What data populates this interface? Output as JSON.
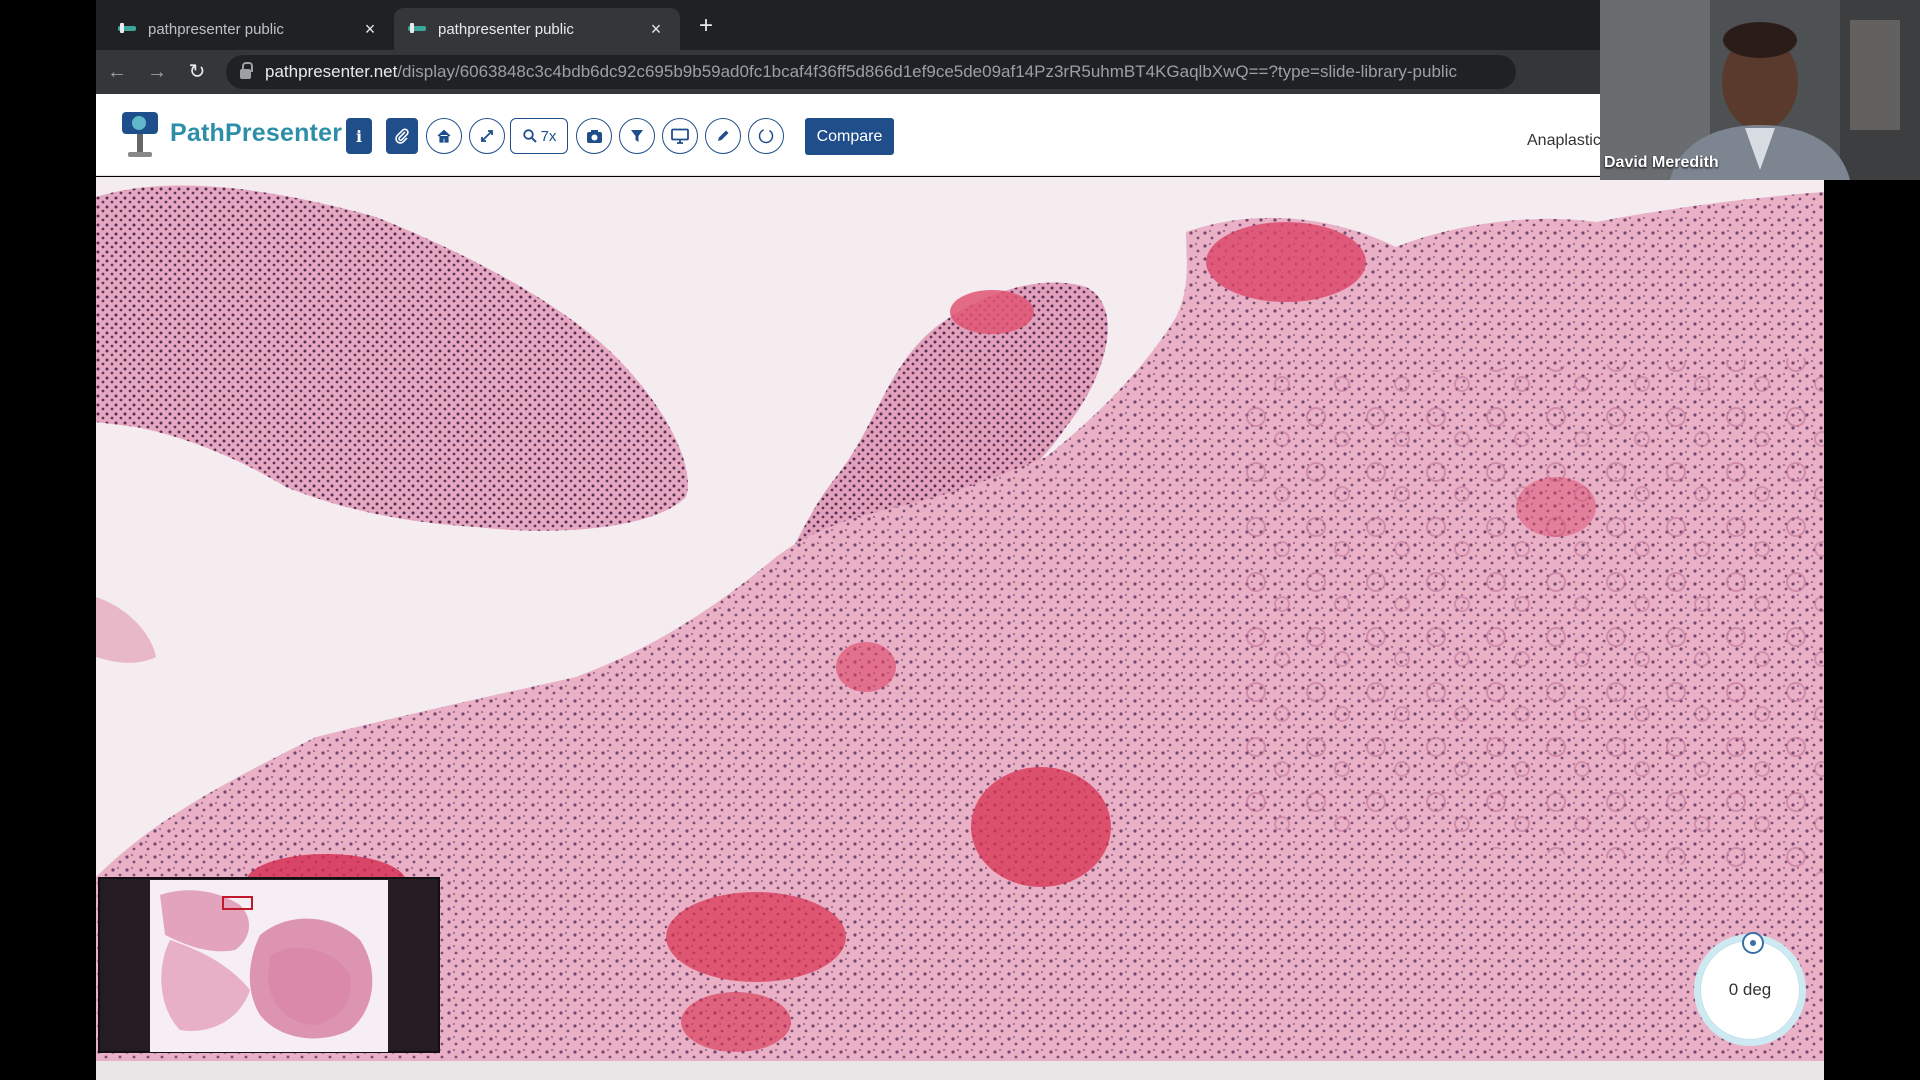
{
  "browser": {
    "tabs": [
      {
        "title": "pathpresenter public",
        "active": false
      },
      {
        "title": "pathpresenter public",
        "active": true
      }
    ],
    "new_tab_label": "+",
    "url_host": "pathpresenter.net",
    "url_path": "/display/6063848c3c4bdb6dc92c695b9b59ad0fc1bcaf4f36ff5d866d1ef9ce5de09af14Pz3rR5uhmBT4KGaqlbXwQ==?type=slide-library-public"
  },
  "app": {
    "logo_text": "PathPresenter",
    "toolbar": {
      "info_label": "i",
      "zoom_label": "7x",
      "compare_label": "Compare"
    },
    "slide_title": "Anaplastic"
  },
  "viewer": {
    "rotation_label": "0 deg"
  },
  "webcam": {
    "name": "David Meredith"
  },
  "colors": {
    "brand": "#1f4e8b",
    "logo_text": "#2d8ea8",
    "tissue_pink": "#e9a9bf",
    "hemorrhage": "#d9304f",
    "nuclei": "#3a1f45"
  }
}
